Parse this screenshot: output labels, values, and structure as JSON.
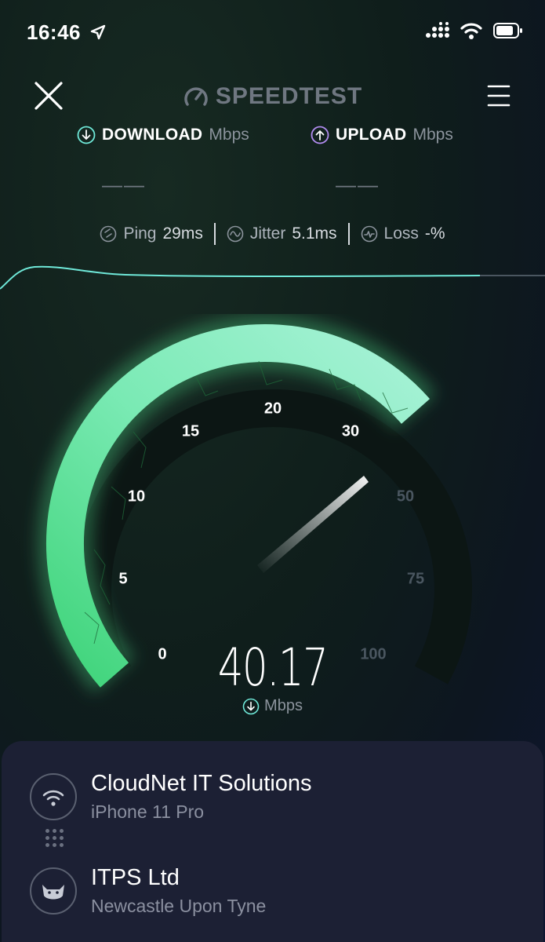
{
  "status_bar": {
    "time": "16:46"
  },
  "header": {
    "brand": "SPEEDTEST"
  },
  "download": {
    "label": "DOWNLOAD",
    "unit": "Mbps",
    "value": "——"
  },
  "upload": {
    "label": "UPLOAD",
    "unit": "Mbps",
    "value": "——"
  },
  "stats": {
    "ping_label": "Ping",
    "ping_value": "29ms",
    "jitter_label": "Jitter",
    "jitter_value": "5.1ms",
    "loss_label": "Loss",
    "loss_value": "-%"
  },
  "gauge": {
    "scale": [
      "0",
      "5",
      "10",
      "15",
      "20",
      "30",
      "50",
      "75",
      "100"
    ],
    "reading": "40.17",
    "reading_unit": "Mbps",
    "reading_value": 40.17
  },
  "colors": {
    "accent": "#5ef0a0",
    "graph_line": "#6fe8d8",
    "card": "#1c2034"
  },
  "connection": {
    "provider": "CloudNet IT Solutions",
    "device": "iPhone 11 Pro",
    "server_name": "ITPS Ltd",
    "server_location": "Newcastle Upon Tyne"
  }
}
